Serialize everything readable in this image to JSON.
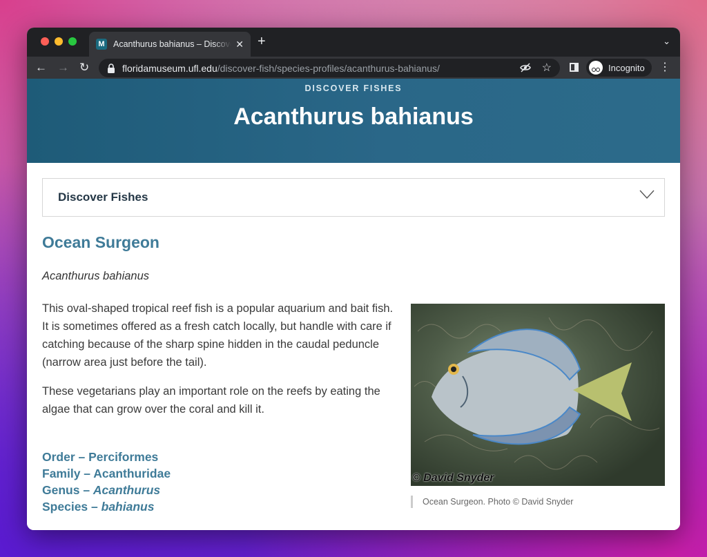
{
  "browser": {
    "tab_title": "Acanthurus bahianus – Discover Fishes",
    "url_host": "floridamuseum.ufl.edu",
    "url_path": "/discover-fish/species-profiles/acanthurus-bahianus/",
    "profile_label": "Incognito"
  },
  "hero": {
    "eyebrow": "DISCOVER FISHES",
    "title": "Acanthurus bahianus"
  },
  "accordion": {
    "label": "Discover Fishes"
  },
  "species": {
    "common_name": "Ocean Surgeon",
    "scientific_name": "Acanthurus bahianus",
    "paragraphs": [
      "This oval-shaped tropical reef fish is a popular aquarium and bait fish. It is sometimes offered as a fresh catch locally, but handle with care if catching because of the sharp spine hidden in the caudal peduncle (narrow area just before the tail).",
      "These vegetarians play an important role on the reefs by eating the algae that can grow over the coral and kill it."
    ],
    "taxonomy": {
      "order_label": "Order – ",
      "order": "Perciformes",
      "family_label": "Family – ",
      "family": "Acanthuridae",
      "genus_label": "Genus – ",
      "genus": "Acanthurus",
      "species_label": "Species – ",
      "species": "bahianus"
    }
  },
  "photo": {
    "credit_overlay": "© David Snyder",
    "caption": "Ocean Surgeon. Photo © David Snyder"
  },
  "colors": {
    "hero_bg": "#2a6788",
    "heading_blue": "#3f7b98",
    "chrome_dark": "#202124"
  }
}
